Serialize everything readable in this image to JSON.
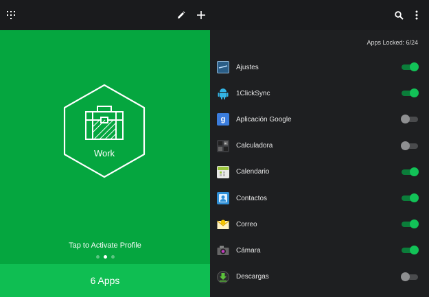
{
  "topbar": {
    "icons": [
      "grid-icon",
      "pencil-icon",
      "plus-icon",
      "search-icon",
      "more-vert-icon"
    ]
  },
  "profile": {
    "name": "Work",
    "tap_hint": "Tap to Activate Profile",
    "apps_button": "6 Apps",
    "pages": 3,
    "active_page": 2
  },
  "apps_locked": "Apps Locked: 6/24",
  "apps": [
    {
      "name": "Ajustes",
      "icon": "settings-icon",
      "locked": true
    },
    {
      "name": "1ClickSync",
      "icon": "android-icon",
      "locked": true
    },
    {
      "name": "Aplicación Google",
      "icon": "google-icon",
      "locked": false
    },
    {
      "name": "Calculadora",
      "icon": "calculator-icon",
      "locked": false
    },
    {
      "name": "Calendario",
      "icon": "calendar-icon",
      "locked": true
    },
    {
      "name": "Contactos",
      "icon": "contacts-icon",
      "locked": true
    },
    {
      "name": "Correo",
      "icon": "mail-icon",
      "locked": true
    },
    {
      "name": "Cámara",
      "icon": "camera-icon",
      "locked": true
    },
    {
      "name": "Descargas",
      "icon": "download-icon",
      "locked": false
    }
  ],
  "colors": {
    "profile_bg": "#05a63f",
    "apps_button_bg": "#0fbe52",
    "toggle_on": "#12c257",
    "panel_bg": "#1e1f21"
  }
}
